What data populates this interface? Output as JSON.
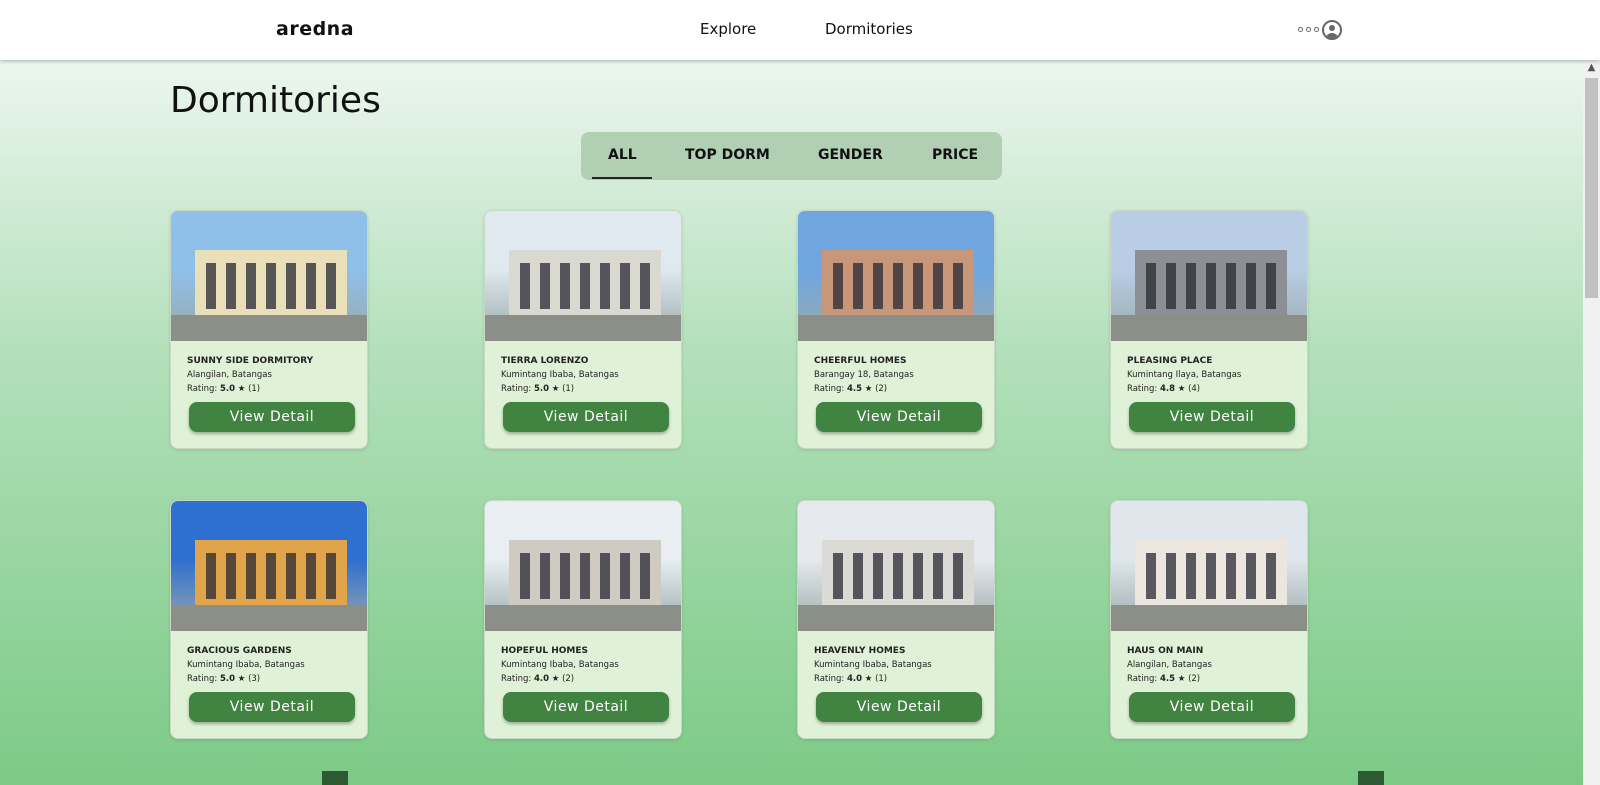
{
  "nav": {
    "brand": "aredna",
    "links": [
      "Explore",
      "Dormitories"
    ]
  },
  "page_title": "Dormitories",
  "tabs": [
    {
      "label": "ALL",
      "active": true
    },
    {
      "label": "TOP DORM"
    },
    {
      "label": "GENDER"
    },
    {
      "label": "PRICE"
    }
  ],
  "button_label": "View Detail",
  "rating_label": "Rating:",
  "dorms": [
    {
      "name": "SUNNY SIDE DORMITORY",
      "location": "Alangilan, Batangas",
      "rating": "5.0",
      "count": "(1)",
      "sky": "#8fc0ea",
      "wall": "#e9dfb8"
    },
    {
      "name": "TIERRA LORENZO",
      "location": "Kumintang Ibaba, Batangas",
      "rating": "5.0",
      "count": "(1)",
      "sky": "#dfe9ef",
      "wall": "#d9d9d2"
    },
    {
      "name": "CHEERFUL HOMES",
      "location": "Barangay 18, Batangas",
      "rating": "4.5",
      "count": "(2)",
      "sky": "#6fa6e0",
      "wall": "#c89678"
    },
    {
      "name": "PLEASING PLACE",
      "location": "Kumintang Ilaya, Batangas",
      "rating": "4.8",
      "count": "(4)",
      "sky": "#b9cde6",
      "wall": "#8d8f95"
    },
    {
      "name": "GRACIOUS GARDENS",
      "location": "Kumintang Ibaba, Batangas",
      "rating": "5.0",
      "count": "(3)",
      "sky": "#2f6fd0",
      "wall": "#e0a44a"
    },
    {
      "name": "HOPEFUL HOMES",
      "location": "Kumintang Ibaba, Batangas",
      "rating": "4.0",
      "count": "(2)",
      "sky": "#e8eef2",
      "wall": "#cfcac2"
    },
    {
      "name": "HEAVENLY HOMES",
      "location": "Kumintang Ibaba, Batangas",
      "rating": "4.0",
      "count": "(1)",
      "sky": "#e6e9ee",
      "wall": "#dcdad5"
    },
    {
      "name": "HAUS ON MAIN",
      "location": "Alangilan, Batangas",
      "rating": "4.5",
      "count": "(2)",
      "sky": "#dfe6ec",
      "wall": "#ece6de"
    }
  ]
}
